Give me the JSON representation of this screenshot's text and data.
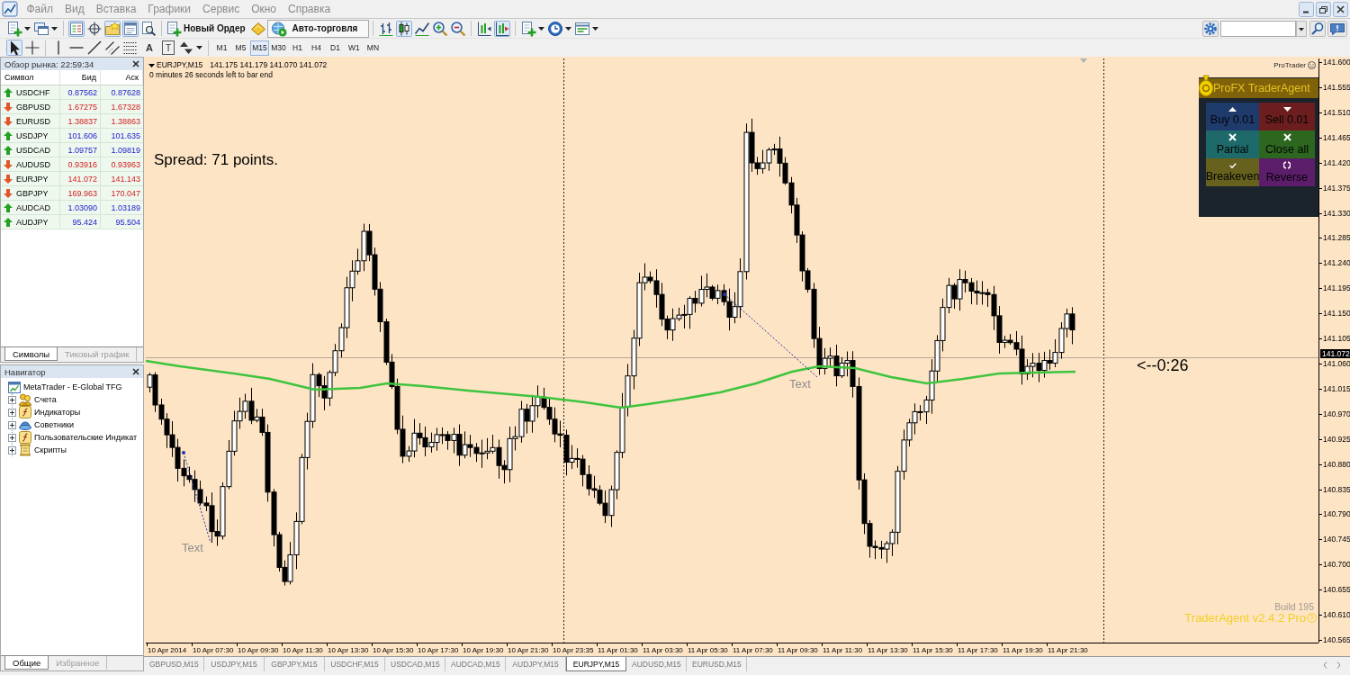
{
  "menu": {
    "items": [
      "Файл",
      "Вид",
      "Вставка",
      "Графики",
      "Сервис",
      "Окно",
      "Справка"
    ]
  },
  "toolbar": {
    "icon_buttons": [
      {
        "pressed": false
      },
      {
        "pressed": false
      },
      {
        "pressed": true
      },
      {
        "pressed": false
      },
      {
        "pressed": true
      },
      {
        "pressed": true
      },
      {
        "pressed": false
      },
      {
        "pressed": false
      },
      {
        "pressed": false
      },
      {
        "pressed": true
      },
      {
        "pressed": false
      },
      {
        "pressed": false
      },
      {
        "pressed": false
      },
      {
        "pressed": false
      },
      {
        "pressed": true
      },
      {
        "pressed": false
      },
      {
        "pressed": false
      },
      {
        "pressed": false
      }
    ],
    "new_order": "Новый Ордер",
    "auto_trading": "Авто-торговля"
  },
  "drawing_toolbar": {
    "tools": [
      {
        "pressed": true
      },
      {
        "pressed": false
      },
      {
        "pressed": false
      },
      {
        "pressed": false
      },
      {
        "pressed": false
      },
      {
        "pressed": false
      },
      {
        "pressed": false
      },
      {
        "pressed": false
      }
    ],
    "text_tools": [
      "A",
      "T"
    ],
    "timeframes": [
      {
        "label": "M1",
        "selected": false
      },
      {
        "label": "M5",
        "selected": false
      },
      {
        "label": "M15",
        "selected": true
      },
      {
        "label": "M30",
        "selected": false
      },
      {
        "label": "H1",
        "selected": false
      },
      {
        "label": "H4",
        "selected": false
      },
      {
        "label": "D1",
        "selected": false
      },
      {
        "label": "W1",
        "selected": false
      },
      {
        "label": "MN",
        "selected": false
      }
    ]
  },
  "market_watch": {
    "title": "Обзор рынка: 22:59:34",
    "columns": [
      "Символ",
      "Бид",
      "Аск"
    ],
    "rows": [
      {
        "symbol": "USDCHF",
        "rising": true,
        "bid": "0.87562",
        "ask": "0.87628"
      },
      {
        "symbol": "GBPUSD",
        "rising": false,
        "bid": "1.67275",
        "ask": "1.67328"
      },
      {
        "symbol": "EURUSD",
        "rising": false,
        "bid": "1.38837",
        "ask": "1.38863"
      },
      {
        "symbol": "USDJPY",
        "rising": true,
        "bid": "101.606",
        "ask": "101.635"
      },
      {
        "symbol": "USDCAD",
        "rising": true,
        "bid": "1.09757",
        "ask": "1.09819"
      },
      {
        "symbol": "AUDUSD",
        "rising": false,
        "bid": "0.93916",
        "ask": "0.93963"
      },
      {
        "symbol": "EURJPY",
        "rising": false,
        "bid": "141.072",
        "ask": "141.143"
      },
      {
        "symbol": "GBPJPY",
        "rising": false,
        "bid": "169.963",
        "ask": "170.047"
      },
      {
        "symbol": "AUDCAD",
        "rising": true,
        "bid": "1.03090",
        "ask": "1.03189"
      },
      {
        "symbol": "AUDJPY",
        "rising": true,
        "bid": "95.424",
        "ask": "95.504"
      }
    ],
    "tabs": [
      {
        "label": "Символы",
        "selected": true
      },
      {
        "label": "Тиковый график",
        "selected": false
      }
    ]
  },
  "navigator": {
    "title": "Навигатор",
    "tree": [
      {
        "label": "MetaTrader - E-Global TFG",
        "children": [
          {
            "label": "Счета",
            "expanded": false
          },
          {
            "label": "Индикаторы",
            "expanded": false
          },
          {
            "label": "Советники",
            "expanded": false
          },
          {
            "label": "Пользовательские Индикат",
            "expanded": false
          },
          {
            "label": "Скрипты",
            "expanded": false
          }
        ]
      }
    ],
    "tabs": [
      {
        "label": "Общие",
        "selected": true
      },
      {
        "label": "Избранное",
        "selected": false
      }
    ]
  },
  "chart": {
    "symbol": "EURJPY,M15",
    "ohlc": "141.175 141.179 141.070 141.072",
    "timer": "0 minutes 26 seconds left to bar end",
    "spread": "Spread: 71 points.",
    "countdown": "<--0:26",
    "object_labels": [
      "Text",
      "Text"
    ],
    "indicator_label": "ProTrader",
    "trader_agent": {
      "title": "ProFX TraderAgent",
      "buttons": [
        {
          "label": "Buy 0.01",
          "color": "#1f3b6c"
        },
        {
          "label": "Sell 0.01",
          "color": "#6c1e1e"
        },
        {
          "label": "Partial",
          "color": "#1e6a6a"
        },
        {
          "label": "Close all",
          "color": "#2c661f"
        },
        {
          "label": "Breakeven",
          "color": "#66611d"
        },
        {
          "label": "Reverse",
          "color": "#5c1d6a"
        }
      ],
      "build": "Build 195",
      "version": "TraderAgent v2.4.2 Pro"
    },
    "price_axis": {
      "labels": [
        "141.600",
        "141.555",
        "141.510",
        "141.465",
        "141.420",
        "141.375",
        "141.330",
        "141.285",
        "141.240",
        "141.195",
        "141.150",
        "141.105",
        "141.060",
        "141.015",
        "140.970",
        "140.925",
        "140.880",
        "140.835",
        "140.790",
        "140.745",
        "140.700",
        "140.655",
        "140.610",
        "140.565"
      ],
      "current": "141.072"
    },
    "time_axis": {
      "labels": [
        "10 Apr 2014",
        "10 Apr 07:30",
        "10 Apr 09:30",
        "10 Apr 11:30",
        "10 Apr 13:30",
        "10 Apr 15:30",
        "10 Apr 17:30",
        "10 Apr 19:30",
        "10 Apr 21:30",
        "10 Apr 23:35",
        "11 Apr 01:30",
        "11 Apr 03:30",
        "11 Apr 05:30",
        "11 Apr 07:30",
        "11 Apr 09:30",
        "11 Apr 11:30",
        "11 Apr 13:30",
        "11 Apr 15:30",
        "11 Apr 17:30",
        "11 Apr 19:30",
        "11 Apr 21:30"
      ]
    }
  },
  "chart_tabs": [
    {
      "label": "GBPUSD,M15",
      "selected": false
    },
    {
      "label": "USDJPY,M15",
      "selected": false
    },
    {
      "label": "GBPJPY,M15",
      "selected": false
    },
    {
      "label": "USDCHF,M15",
      "selected": false
    },
    {
      "label": "USDCAD,M15",
      "selected": false
    },
    {
      "label": "AUDCAD,M15",
      "selected": false
    },
    {
      "label": "AUDJPY,M15",
      "selected": false
    },
    {
      "label": "EURJPY,M15",
      "selected": true
    },
    {
      "label": "AUDUSD,M15",
      "selected": false
    },
    {
      "label": "EURUSD,M15",
      "selected": false
    }
  ]
}
